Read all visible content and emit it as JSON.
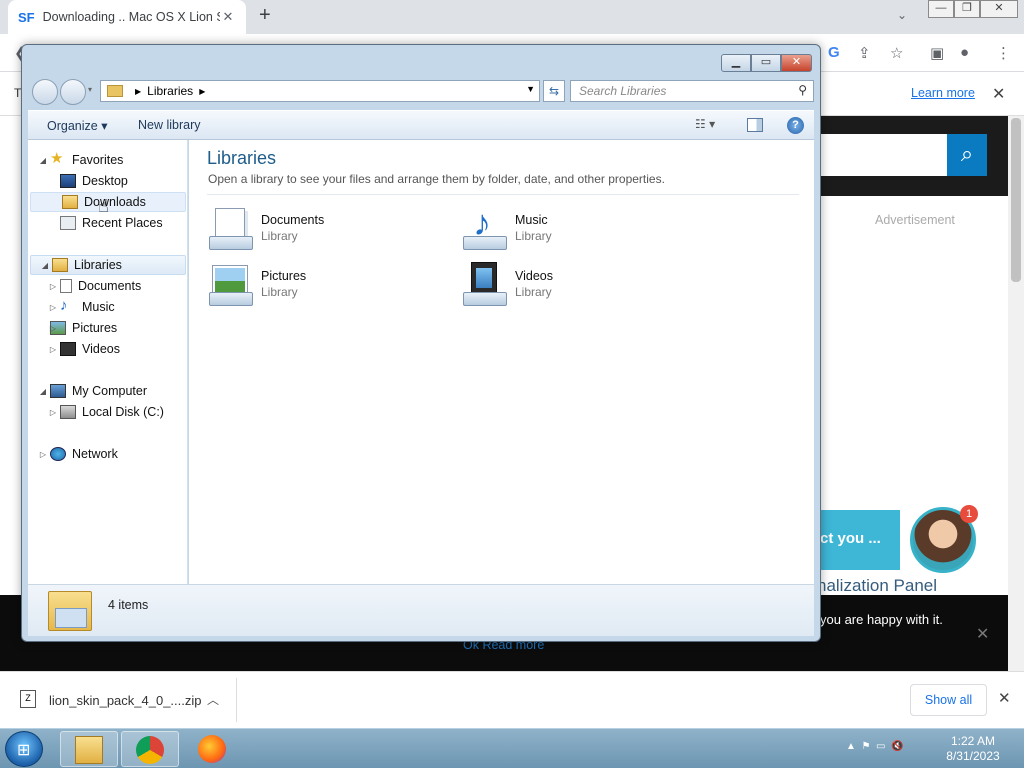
{
  "browser": {
    "tab_icon": "SF",
    "tab_title": "Downloading .. Mac OS X Lion Sk",
    "tab_close": "✕",
    "new_tab": "+",
    "infobar_learn_more": "Learn more",
    "infobar_close": "✕"
  },
  "page": {
    "advertisement": "Advertisement",
    "chat_text": "ct you ...",
    "chat_badge": "1",
    "panel_text": "nalization Panel",
    "cookie_text": "you are happy with it.",
    "cookie_links": "Ok   Read more"
  },
  "explorer": {
    "address": {
      "root_label": "Libraries",
      "search_placeholder": "Search Libraries"
    },
    "commands": {
      "organize": "Organize ▾",
      "new_library": "New library"
    },
    "nav_tree": [
      {
        "label": "Favorites",
        "icon": "star-icon",
        "level": 0,
        "arrow": "◢"
      },
      {
        "label": "Desktop",
        "icon": "desktop-icon",
        "level": 1,
        "arrow": ""
      },
      {
        "label": "Downloads",
        "icon": "downloads-folder-icon",
        "level": 1,
        "arrow": ""
      },
      {
        "label": "Recent Places",
        "icon": "recent-places-icon",
        "level": 1,
        "arrow": ""
      },
      {
        "label": "Libraries",
        "icon": "libraries-icon",
        "level": 0,
        "arrow": "◢"
      },
      {
        "label": "Documents",
        "icon": "documents-icon",
        "level": 1,
        "arrow": "▷"
      },
      {
        "label": "Music",
        "icon": "music-icon",
        "level": 1,
        "arrow": "▷"
      },
      {
        "label": "Pictures",
        "icon": "pictures-icon",
        "level": 1,
        "arrow": "▷"
      },
      {
        "label": "Videos",
        "icon": "videos-icon",
        "level": 1,
        "arrow": "▷"
      },
      {
        "label": "My Computer",
        "icon": "computer-icon",
        "level": 0,
        "arrow": "◢"
      },
      {
        "label": "Local Disk (C:)",
        "icon": "disk-icon",
        "level": 1,
        "arrow": "▷"
      },
      {
        "label": "Network",
        "icon": "network-icon",
        "level": 0,
        "arrow": "▷"
      }
    ],
    "content": {
      "title": "Libraries",
      "subtitle": "Open a library to see your files and arrange them by folder, date, and other properties.",
      "items": [
        {
          "name": "Documents",
          "type": "Library",
          "icon": "documents-library-icon"
        },
        {
          "name": "Music",
          "type": "Library",
          "icon": "music-library-icon"
        },
        {
          "name": "Pictures",
          "type": "Library",
          "icon": "pictures-library-icon"
        },
        {
          "name": "Videos",
          "type": "Library",
          "icon": "videos-library-icon"
        }
      ]
    },
    "details": {
      "count": "4 items"
    }
  },
  "download_shelf": {
    "filename": "lion_skin_pack_4_0_....zip",
    "show_all": "Show all",
    "close": "✕"
  },
  "taskbar": {
    "time": "1:22 AM",
    "date": "8/31/2023"
  }
}
